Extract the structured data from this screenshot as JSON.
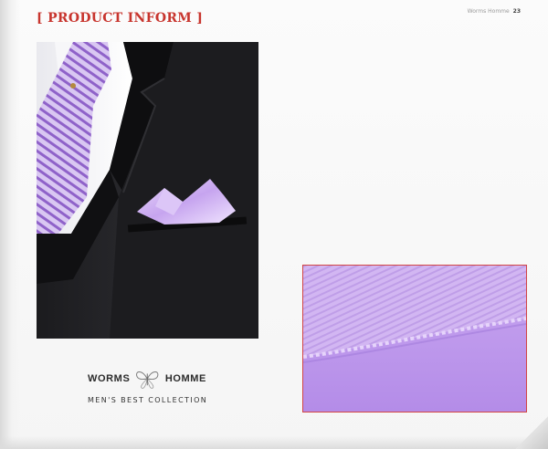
{
  "header": {
    "section_title": "[ PRODUCT INFORM ]",
    "page_label": "Worms Homme",
    "page_number": "23"
  },
  "brand": {
    "left_word": "WORMS",
    "right_word": "HOMME",
    "tagline": "MEN'S BEST COLLECTION",
    "logo_icon": "butterfly-emblem-icon"
  },
  "images": {
    "suit_photo": "black suit with lavender striped tie and lavender pocket square",
    "fabric_detail": "close-up of lavender fabric with stitched hem"
  },
  "colors": {
    "title_red": "#c8352e",
    "lavender": "#c9a8ef",
    "suit_black": "#141416"
  }
}
